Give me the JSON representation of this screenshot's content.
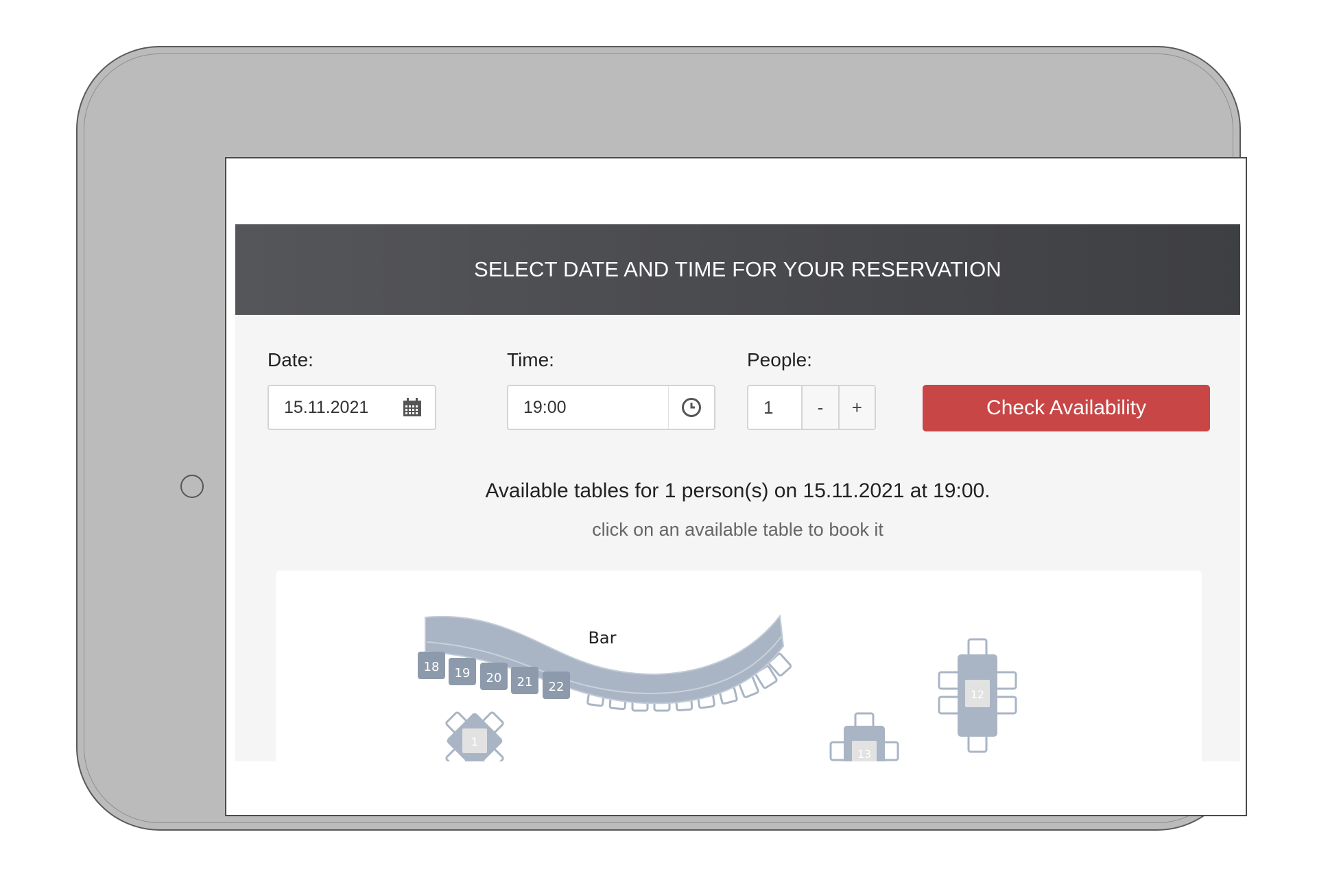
{
  "header": {
    "title": "SELECT DATE AND TIME FOR YOUR RESERVATION"
  },
  "form": {
    "date_label": "Date:",
    "date_value": "15.11.2021",
    "time_label": "Time:",
    "time_value": "19:00",
    "people_label": "People:",
    "people_value": "1",
    "minus_label": "-",
    "plus_label": "+",
    "check_button_label": "Check Availability"
  },
  "availability": {
    "summary": "Available tables for 1 person(s) on 15.11.2021 at 19:00.",
    "hint": "click on an available table to book it"
  },
  "floor_plan": {
    "bar_label": "Bar",
    "bar_seats": [
      "18",
      "19",
      "20",
      "21",
      "22"
    ],
    "tables": [
      "1",
      "12",
      "13"
    ]
  },
  "colors": {
    "header_bg": "#4a4b4f",
    "accent": "#c84646",
    "table_fill": "#a9b5c4",
    "seat_fill": "#8d9aab",
    "panel_bg": "#f5f5f5"
  },
  "icons": {
    "date": "calendar-icon",
    "time": "clock-icon"
  }
}
